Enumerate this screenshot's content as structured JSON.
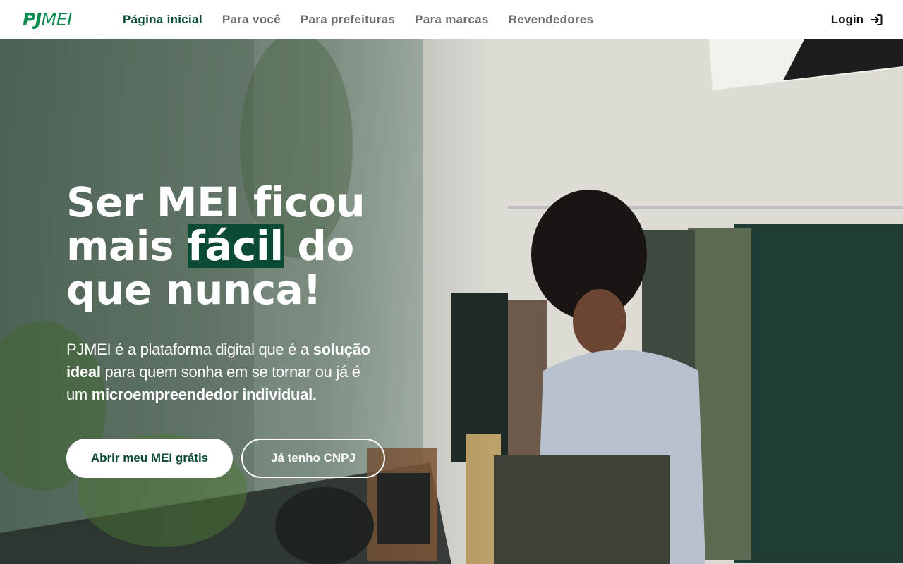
{
  "header": {
    "logo": {
      "part1": "PJ",
      "part2": "MEI"
    },
    "nav": [
      {
        "label": "Página inicial",
        "active": true
      },
      {
        "label": "Para você",
        "active": false
      },
      {
        "label": "Para prefeituras",
        "active": false
      },
      {
        "label": "Para marcas",
        "active": false
      },
      {
        "label": "Revendedores",
        "active": false
      }
    ],
    "login": {
      "label": "Login",
      "icon": "login-arrow-icon"
    }
  },
  "hero": {
    "headline": {
      "line1": "Ser MEI ficou",
      "line2_pre": "mais ",
      "line2_highlight": "fácil",
      "line2_post": " do",
      "line3": "que nunca!"
    },
    "subtext": {
      "p1": "PJMEI é a plataforma digital que é a ",
      "b1": "solução ideal",
      "p2": " para quem sonha em se tornar ou já é um ",
      "b2": "microempreendedor individual."
    },
    "cta_primary": "Abrir meu MEI grátis",
    "cta_secondary": "Já tenho CNPJ"
  },
  "colors": {
    "brand_green": "#0d8a4f",
    "dark_green": "#0b4a34",
    "nav_gray": "#6f6f6f"
  }
}
